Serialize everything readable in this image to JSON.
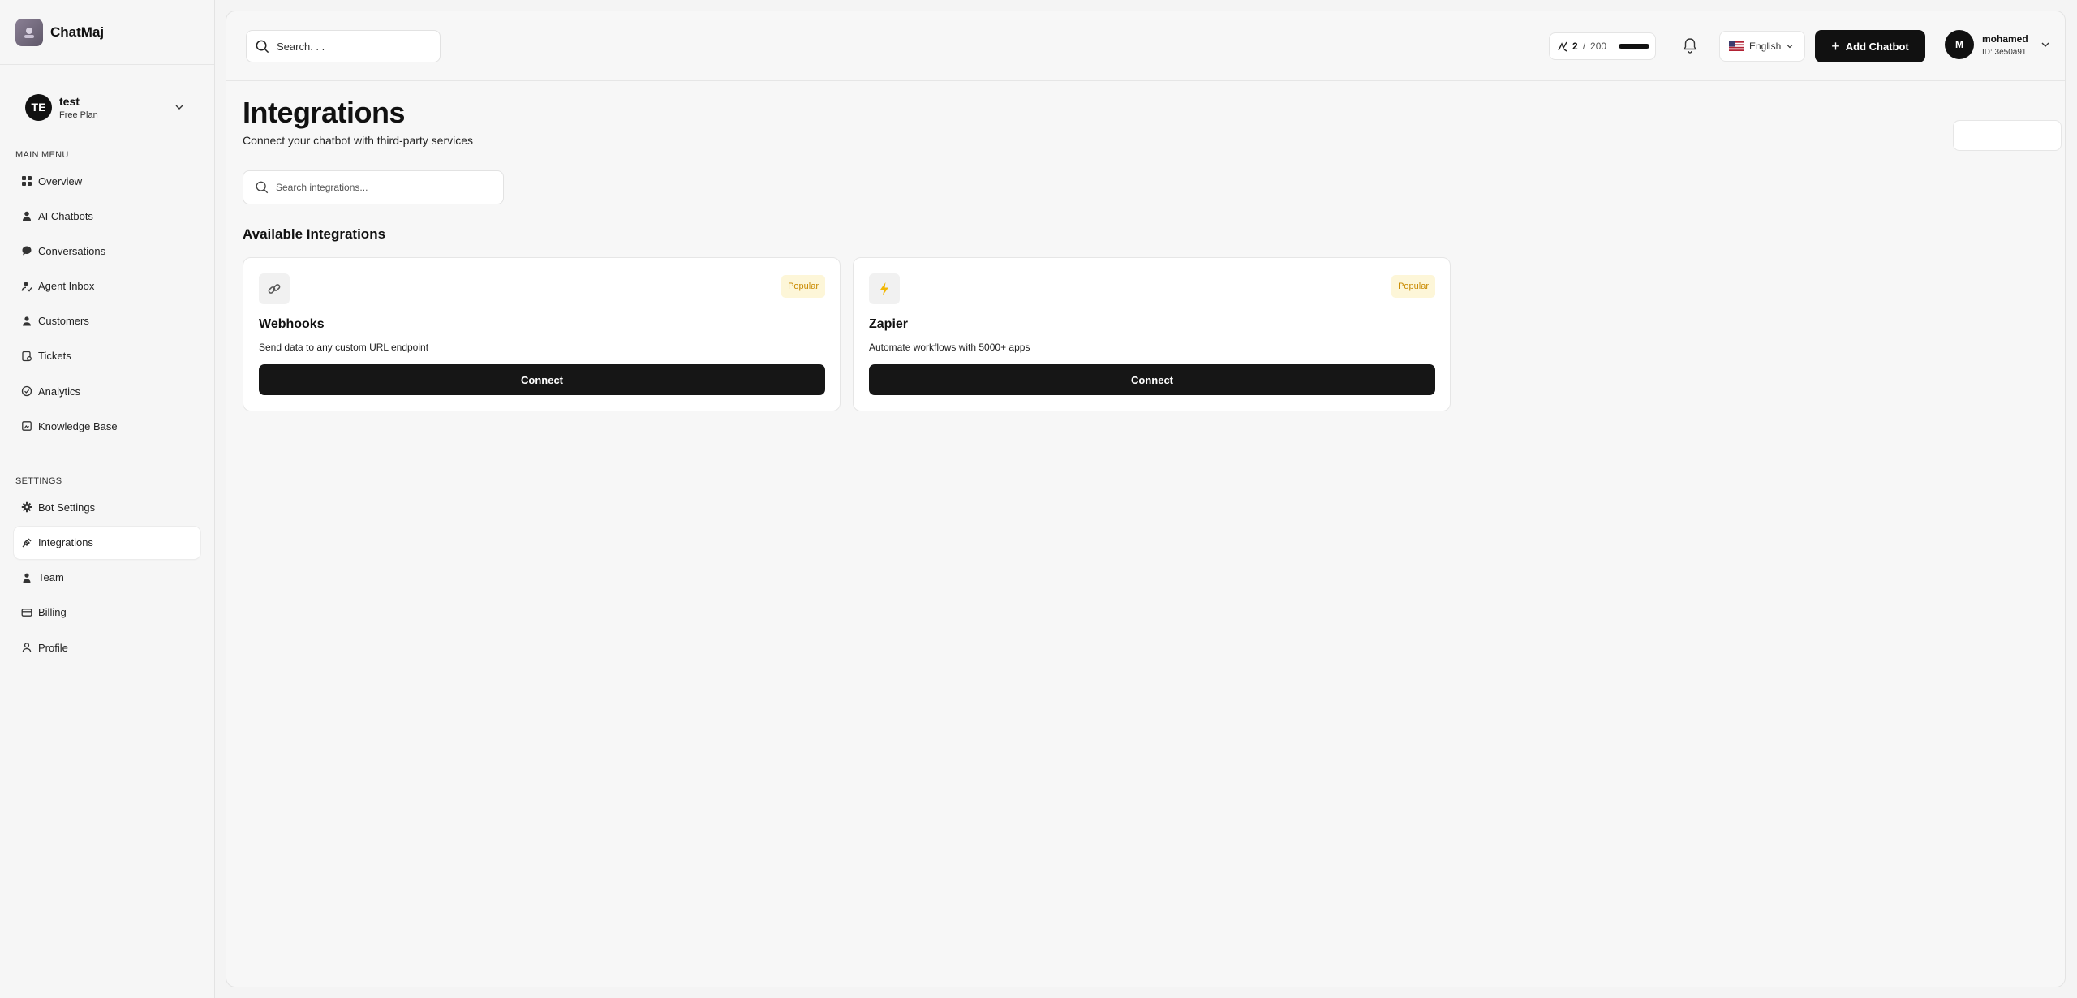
{
  "brand": {
    "name": "ChatMaj"
  },
  "workspace": {
    "initials": "TE",
    "name": "test",
    "plan": "Free Plan"
  },
  "sidebar": {
    "main_menu_label": "MAIN MENU",
    "main_items": [
      {
        "label": "Overview",
        "icon": "grid-icon"
      },
      {
        "label": "AI Chatbots",
        "icon": "person-icon"
      },
      {
        "label": "Conversations",
        "icon": "chat-bubble-icon"
      },
      {
        "label": "Agent Inbox",
        "icon": "agent-icon"
      },
      {
        "label": "Customers",
        "icon": "users-icon"
      },
      {
        "label": "Tickets",
        "icon": "ticket-icon"
      },
      {
        "label": "Analytics",
        "icon": "chart-check-icon"
      },
      {
        "label": "Knowledge Base",
        "icon": "book-icon"
      }
    ],
    "settings_label": "SETTINGS",
    "settings_items": [
      {
        "label": "Bot Settings",
        "icon": "gear-icon"
      },
      {
        "label": "Integrations",
        "icon": "plug-icon",
        "active": true
      },
      {
        "label": "Team",
        "icon": "team-icon"
      },
      {
        "label": "Billing",
        "icon": "card-icon"
      },
      {
        "label": "Profile",
        "icon": "profile-icon"
      }
    ]
  },
  "topbar": {
    "search_placeholder": "Search. . .",
    "credits": {
      "used": "2",
      "separator": "/",
      "total": "200"
    },
    "language": "English",
    "add_chatbot_label": "Add Chatbot",
    "user": {
      "initial": "M",
      "name": "mohamed",
      "id": "ID: 3e50a91"
    }
  },
  "page": {
    "title": "Integrations",
    "subtitle": "Connect your chatbot with third-party services",
    "search_placeholder": "Search integrations...",
    "section_title": "Available Integrations"
  },
  "integrations": [
    {
      "name": "Webhooks",
      "description": "Send data to any custom URL endpoint",
      "badge": "Popular",
      "icon": "link-icon",
      "button": "Connect"
    },
    {
      "name": "Zapier",
      "description": "Automate workflows with 5000+ apps",
      "badge": "Popular",
      "icon": "lightning-icon",
      "button": "Connect"
    }
  ],
  "colors": {
    "primary": "#111111",
    "badge_bg": "#fdf6d8",
    "badge_text": "#c98a00",
    "background": "#f4f4f4"
  }
}
